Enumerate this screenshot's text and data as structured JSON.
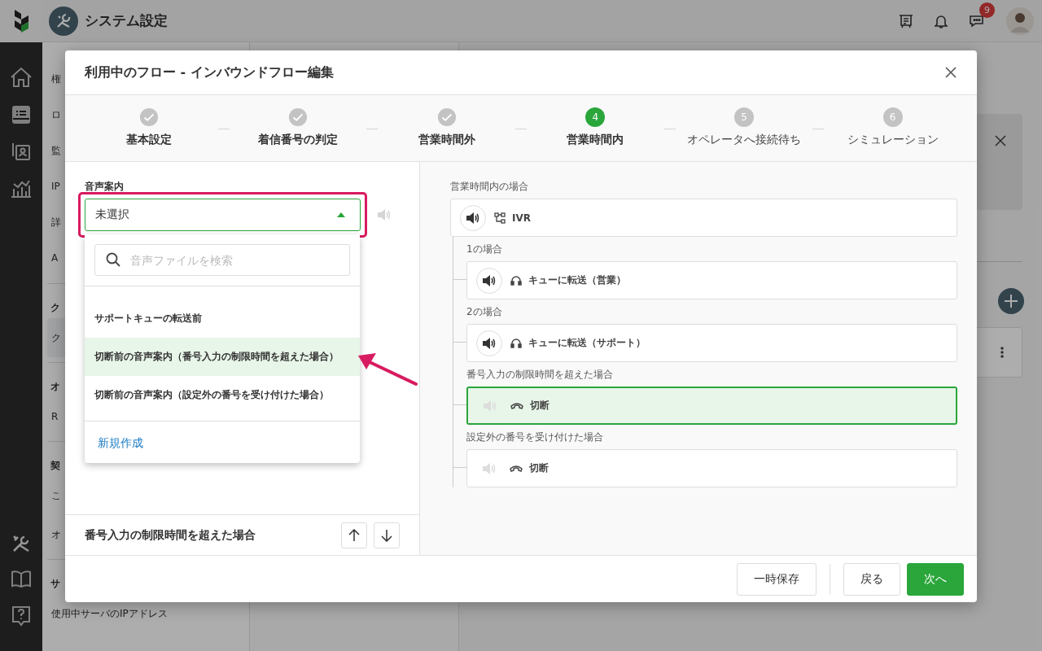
{
  "app": {
    "title": "システム設定",
    "chat_badge": "9"
  },
  "sidebar": {
    "sections": [
      {
        "items": [
          {
            "label": "権",
            "selected": false
          },
          {
            "label": "ロ",
            "selected": false
          },
          {
            "label": "監",
            "selected": false
          },
          {
            "label": "IP",
            "selected": false
          },
          {
            "label": "詳",
            "selected": false
          },
          {
            "label": "A",
            "selected": false
          }
        ]
      },
      {
        "heading": "ク",
        "items": [
          {
            "label": "ク",
            "selected": true
          }
        ]
      },
      {
        "heading": "オ",
        "items": [
          {
            "label": "R",
            "selected": false
          }
        ]
      },
      {
        "heading": "契",
        "items": [
          {
            "label": "こ",
            "selected": false
          },
          {
            "label": "オ",
            "selected": false
          }
        ]
      },
      {
        "heading": "サ",
        "items": [
          {
            "label": "使用中サーバのIPアドレス",
            "selected": false
          }
        ]
      }
    ]
  },
  "modal": {
    "title": "利用中のフロー - インバウンドフロー編集",
    "steps": [
      {
        "label": "基本設定",
        "completed": true,
        "selected": false
      },
      {
        "label": "着信番号の判定",
        "completed": true,
        "selected": false
      },
      {
        "label": "営業時間外",
        "completed": true,
        "selected": false
      },
      {
        "number": "4",
        "label": "営業時間内",
        "completed": false,
        "selected": true
      },
      {
        "number": "5",
        "label": "オペレータへ接続待ち",
        "completed": false,
        "selected": false
      },
      {
        "number": "6",
        "label": "シミュレーション",
        "completed": false,
        "selected": false
      }
    ],
    "left": {
      "field_label": "音声案内",
      "select": {
        "value": "未選択",
        "open": true
      },
      "dropdown": {
        "search_placeholder": "音声ファイルを検索",
        "options": [
          {
            "label": "サポートキューの転送前",
            "selected": false
          },
          {
            "label": "切断前の音声案内（番号入力の制限時間を超えた場合）",
            "selected": true
          },
          {
            "label": "切断前の音声案内（設定外の番号を受け付けた場合）",
            "selected": false
          }
        ],
        "create_link": "新規作成"
      },
      "bottom_title": "番号入力の制限時間を超えた場合"
    },
    "right": {
      "heading": "営業時間内の場合",
      "root": {
        "kind": "ivr",
        "label": "IVR",
        "audio": true,
        "selected": false
      },
      "branches": [
        {
          "condition": "1の場合",
          "kind": "queue",
          "label": "キューに転送（営業）",
          "audio": true,
          "selected": false
        },
        {
          "condition": "2の場合",
          "kind": "queue",
          "label": "キューに転送（サポート）",
          "audio": true,
          "selected": false
        },
        {
          "condition": "番号入力の制限時間を超えた場合",
          "kind": "hangup",
          "label": "切断",
          "audio": false,
          "selected": true
        },
        {
          "condition": "設定外の番号を受け付けた場合",
          "kind": "hangup",
          "label": "切断",
          "audio": false,
          "selected": false
        }
      ]
    },
    "buttons": [
      {
        "label": "一時保存",
        "kind": "secondary"
      },
      {
        "label": "戻る",
        "kind": "secondary"
      },
      {
        "label": "次へ",
        "kind": "primary"
      }
    ]
  }
}
